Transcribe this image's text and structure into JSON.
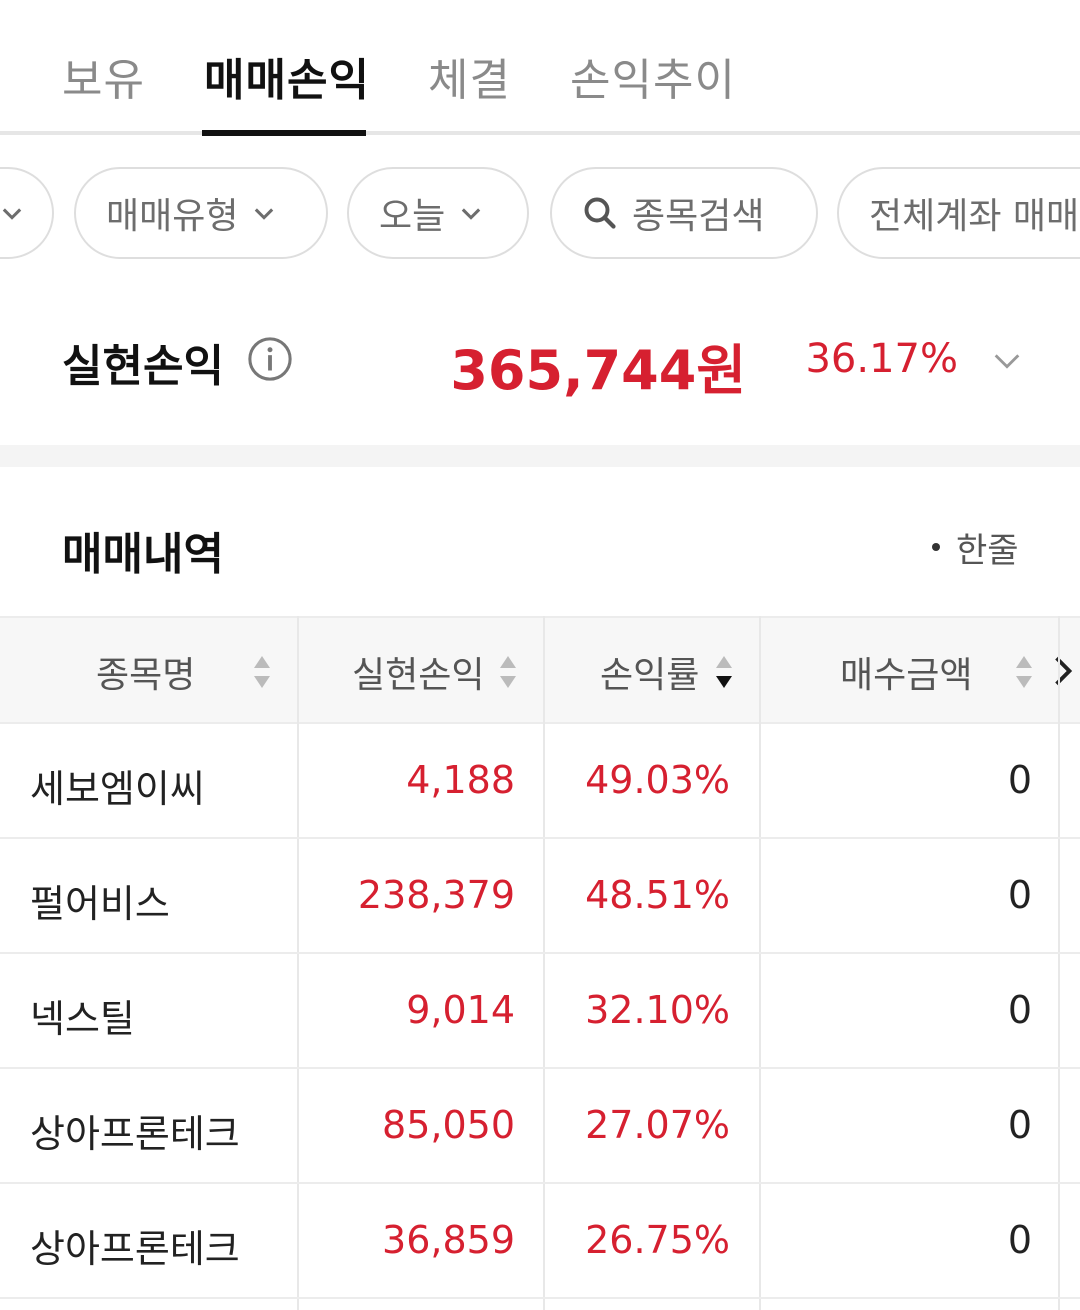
{
  "tabs": [
    {
      "label": "보유",
      "active": false
    },
    {
      "label": "매매손익",
      "active": true
    },
    {
      "label": "체결",
      "active": false
    },
    {
      "label": "손익추이",
      "active": false
    }
  ],
  "filters": {
    "trade_type": "매매유형",
    "period": "오늘",
    "stock_search": "종목검색",
    "all_accounts": "전체계좌 매매"
  },
  "summary": {
    "label": "실현손익",
    "amount": "365,744원",
    "rate": "36.17%"
  },
  "history": {
    "title": "매매내역",
    "view_mode": "한줄"
  },
  "table": {
    "columns": [
      "종목명",
      "실현손익",
      "손익률",
      "매수금액"
    ],
    "rows": [
      {
        "name": "세보엠이씨",
        "pnl": "4,188",
        "rate": "49.03%",
        "amount": "0"
      },
      {
        "name": "펄어비스",
        "pnl": "238,379",
        "rate": "48.51%",
        "amount": "0"
      },
      {
        "name": "넥스틸",
        "pnl": "9,014",
        "rate": "32.10%",
        "amount": "0"
      },
      {
        "name": "상아프론테크",
        "pnl": "85,050",
        "rate": "27.07%",
        "amount": "0"
      },
      {
        "name": "상아프론테크",
        "pnl": "36,859",
        "rate": "26.75%",
        "amount": "0"
      }
    ]
  },
  "colors": {
    "profit_red": "#d62030",
    "active_tab": "#111111",
    "inactive_tab": "#8a8a8a"
  }
}
